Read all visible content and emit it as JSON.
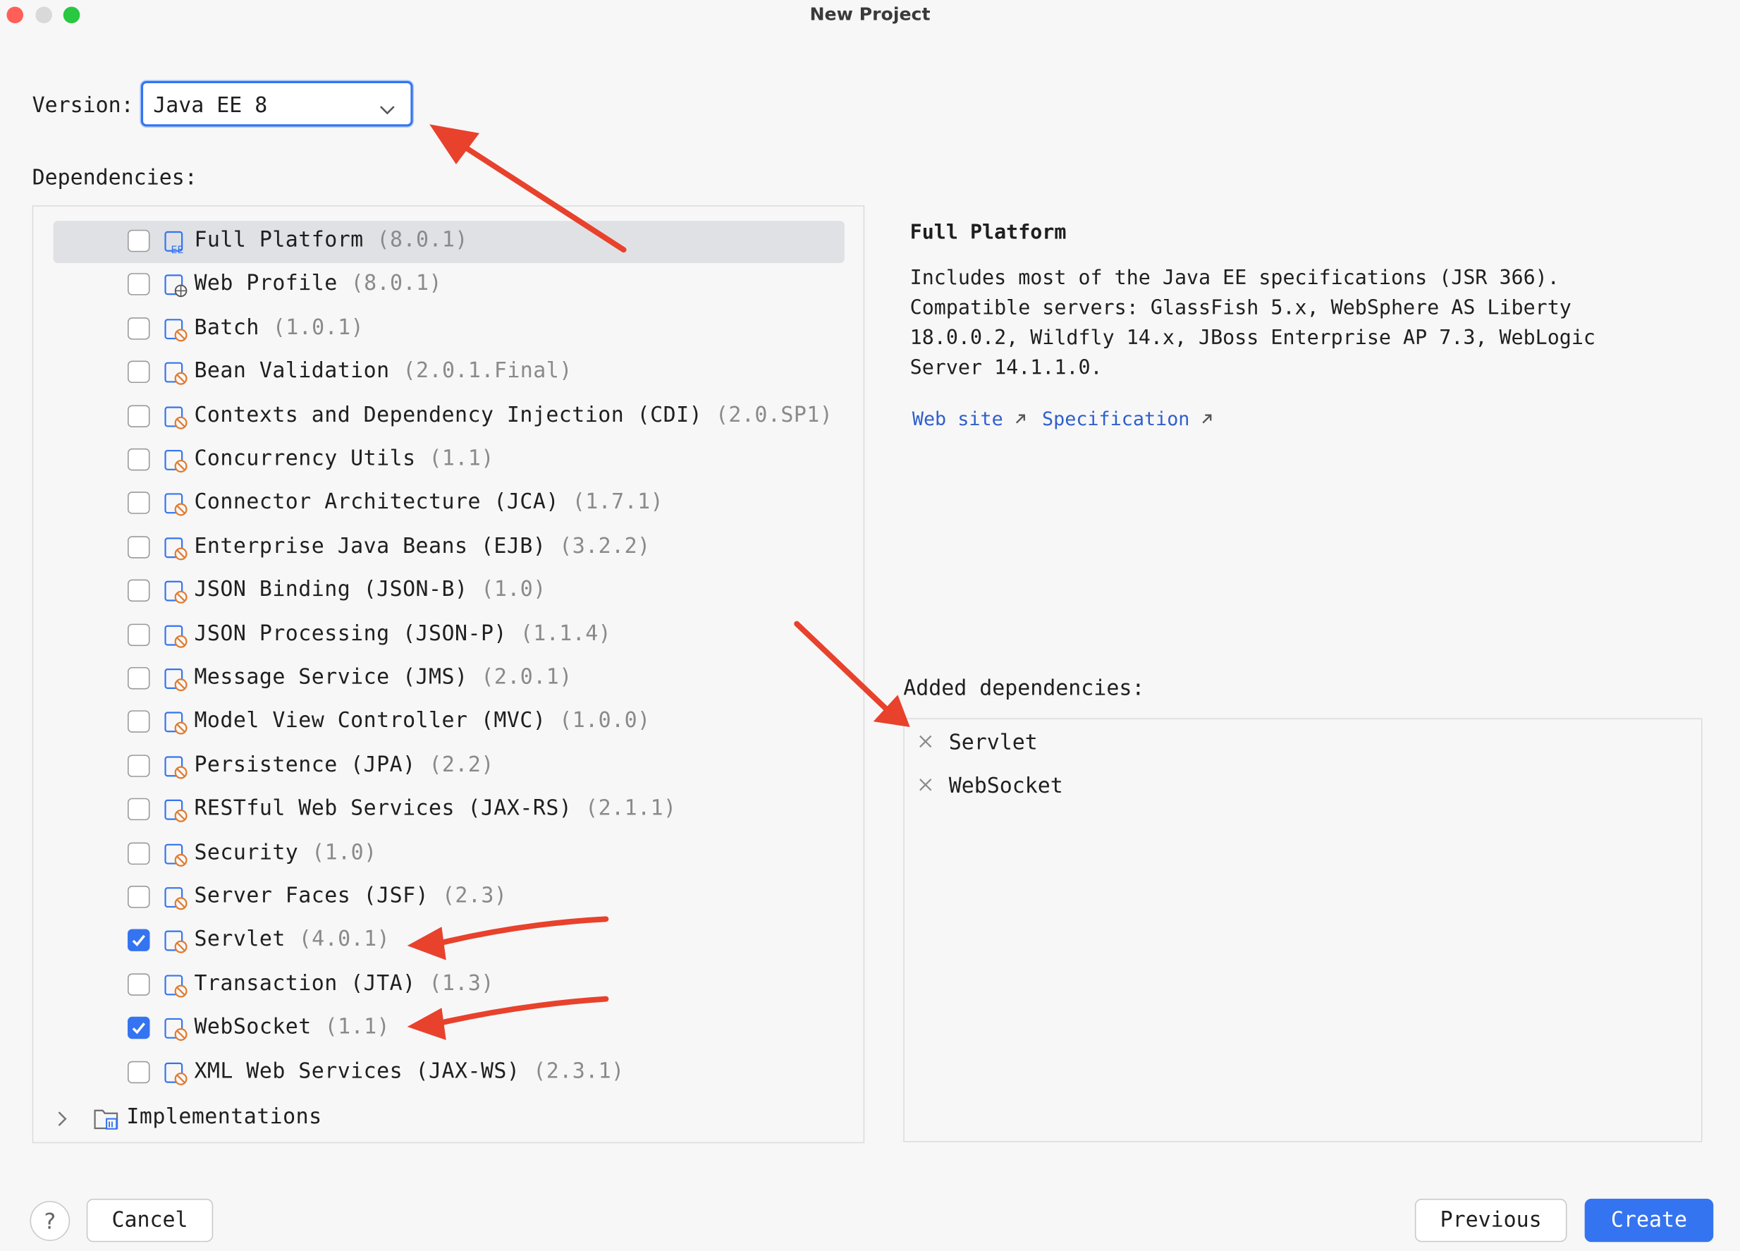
{
  "window": {
    "title": "New Project",
    "traffic_colors": [
      "#ff5f57",
      "#d9d9d9",
      "#28c840"
    ]
  },
  "version": {
    "label": "Version:",
    "selected": "Java EE 8"
  },
  "dependencies": {
    "label": "Dependencies:",
    "items": [
      {
        "name": "Full Platform",
        "version": "(8.0.1)",
        "checked": false,
        "selected": true,
        "icon": "ee-platform-icon"
      },
      {
        "name": "Web Profile",
        "version": "(8.0.1)",
        "checked": false,
        "icon": "web-profile-icon"
      },
      {
        "name": "Batch",
        "version": "(1.0.1)",
        "checked": false,
        "icon": "library-icon"
      },
      {
        "name": "Bean Validation",
        "version": "(2.0.1.Final)",
        "checked": false,
        "icon": "library-icon"
      },
      {
        "name": "Contexts and Dependency Injection (CDI)",
        "version": "(2.0.SP1)",
        "checked": false,
        "icon": "library-icon"
      },
      {
        "name": "Concurrency Utils",
        "version": "(1.1)",
        "checked": false,
        "icon": "library-icon"
      },
      {
        "name": "Connector Architecture (JCA)",
        "version": "(1.7.1)",
        "checked": false,
        "icon": "library-icon"
      },
      {
        "name": "Enterprise Java Beans (EJB)",
        "version": "(3.2.2)",
        "checked": false,
        "icon": "library-icon"
      },
      {
        "name": "JSON Binding (JSON-B)",
        "version": "(1.0)",
        "checked": false,
        "icon": "library-icon"
      },
      {
        "name": "JSON Processing (JSON-P)",
        "version": "(1.1.4)",
        "checked": false,
        "icon": "library-icon"
      },
      {
        "name": "Message Service (JMS)",
        "version": "(2.0.1)",
        "checked": false,
        "icon": "library-icon"
      },
      {
        "name": "Model View Controller (MVC)",
        "version": "(1.0.0)",
        "checked": false,
        "icon": "library-icon"
      },
      {
        "name": "Persistence (JPA)",
        "version": "(2.2)",
        "checked": false,
        "icon": "library-icon"
      },
      {
        "name": "RESTful Web Services (JAX-RS)",
        "version": "(2.1.1)",
        "checked": false,
        "icon": "library-icon"
      },
      {
        "name": "Security",
        "version": "(1.0)",
        "checked": false,
        "icon": "library-icon"
      },
      {
        "name": "Server Faces (JSF)",
        "version": "(2.3)",
        "checked": false,
        "icon": "library-icon"
      },
      {
        "name": "Servlet",
        "version": "(4.0.1)",
        "checked": true,
        "icon": "library-icon"
      },
      {
        "name": "Transaction (JTA)",
        "version": "(1.3)",
        "checked": false,
        "icon": "library-icon"
      },
      {
        "name": "WebSocket",
        "version": "(1.1)",
        "checked": true,
        "icon": "library-icon"
      },
      {
        "name": "XML Web Services (JAX-WS)",
        "version": "(2.3.1)",
        "checked": false,
        "icon": "library-icon"
      }
    ],
    "group": {
      "name": "Implementations",
      "icon": "folder-icon",
      "expanded": false
    }
  },
  "details": {
    "title": "Full Platform",
    "description": "Includes most of the Java EE specifications (JSR 366).\nCompatible servers: GlassFish 5.x, WebSphere AS Liberty\n18.0.0.2, Wildfly 14.x, JBoss Enterprise AP 7.3, WebLogic\nServer 14.1.1.0.",
    "links": [
      {
        "label": "Web site",
        "icon": "external-link-icon"
      },
      {
        "label": "Specification",
        "icon": "external-link-icon"
      }
    ]
  },
  "added": {
    "label": "Added dependencies:",
    "items": [
      "Servlet",
      "WebSocket"
    ]
  },
  "buttons": {
    "help": "?",
    "cancel": "Cancel",
    "previous": "Previous",
    "create": "Create"
  },
  "colors": {
    "accent": "#3574f0",
    "annotation_arrow": "#e8412c",
    "library_icon_badge": "#e07a2e"
  }
}
